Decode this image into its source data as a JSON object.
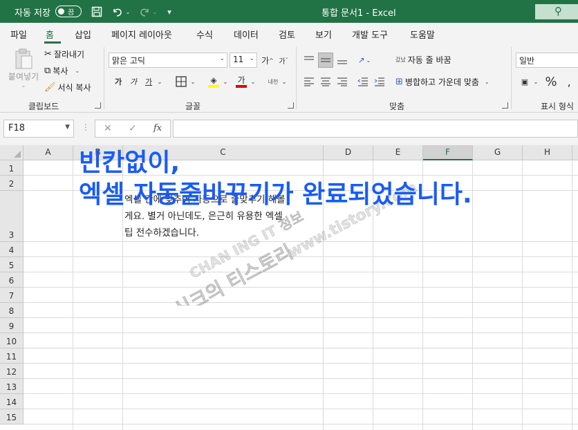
{
  "titlebar": {
    "autosave_label": "자동 저장",
    "autosave_toggle": "끔",
    "doc_title": "통합 문서1  -  Excel"
  },
  "tabs": [
    {
      "label": "파일"
    },
    {
      "label": "홈"
    },
    {
      "label": "삽입"
    },
    {
      "label": "페이지 레이아웃"
    },
    {
      "label": "수식"
    },
    {
      "label": "데이터"
    },
    {
      "label": "검토"
    },
    {
      "label": "보기"
    },
    {
      "label": "개발 도구"
    },
    {
      "label": "도움말"
    }
  ],
  "ribbon": {
    "clipboard": {
      "paste": "붙여넣기",
      "cut": "잘라내기",
      "copy": "복사",
      "format_painter": "서식 복사",
      "group_label": "클립보드"
    },
    "font": {
      "font_name": "맑은 고딕",
      "font_size": "11",
      "bold": "가",
      "italic": "가",
      "underline": "가",
      "font_color_glyph": "가",
      "phonetic": "내천",
      "grow": "가",
      "shrink": "가",
      "group_label": "글꼴"
    },
    "alignment": {
      "wrap_text": "자동 줄 바꿈",
      "merge_center": "병합하고 가운데 맞춤",
      "wrap_icon_text": "갔났",
      "group_label": "맞춤"
    },
    "number": {
      "format": "일반",
      "percent": "%",
      "group_label": "표시 형식"
    }
  },
  "formula_bar": {
    "name_box": "F18",
    "fx": "fx",
    "value": ""
  },
  "grid": {
    "columns": [
      "A",
      "B",
      "C",
      "D",
      "E",
      "F",
      "G",
      "H"
    ],
    "selected_column": "F",
    "rows": [
      "1",
      "2",
      "3",
      "4",
      "5",
      "6",
      "7",
      "8",
      "9",
      "10",
      "11",
      "12",
      "13",
      "14",
      "15"
    ],
    "c3_lines": [
      "엑셀 칸에 맞추어 자동으로 줄맞추기 해볼",
      "게요. 별거 아닌데도, 은근히 유용한 엑셀",
      "팁 전수하겠습니다."
    ]
  },
  "overlay": {
    "line1": "빈칸없이,",
    "line2": "엑셀 자동줄바꾸기가 완료되었습니다."
  },
  "watermark": {
    "line1": "CHAN ING IT 정보",
    "line2": "식크의 티스토리",
    "line3": "www.tistory.com"
  },
  "colors": {
    "brand": "#217346",
    "overlay_text": "#1a5cf3"
  }
}
